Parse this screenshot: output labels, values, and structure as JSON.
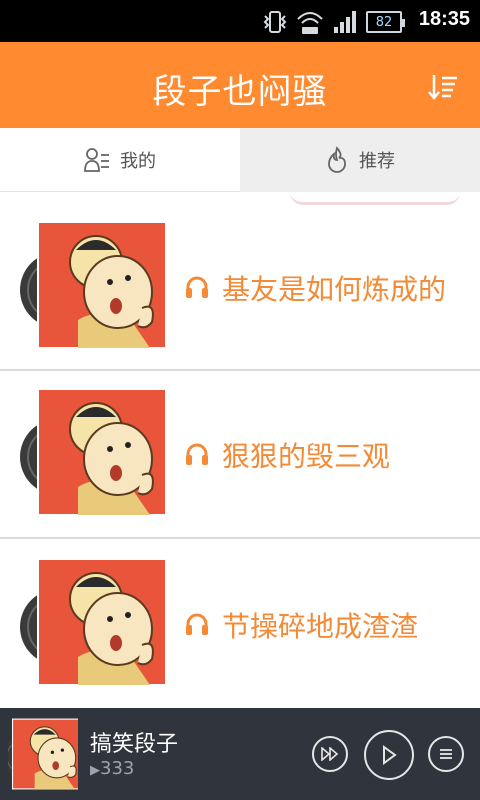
{
  "status_bar": {
    "time": "18:35",
    "battery": "82"
  },
  "header": {
    "title": "段子也闷骚"
  },
  "tabs": [
    {
      "label": "我的",
      "icon": "user-list-icon"
    },
    {
      "label": "推荐",
      "icon": "flame-icon"
    }
  ],
  "list": {
    "items": [
      {
        "title": "基友是如何炼成的",
        "icon": "headphones-icon"
      },
      {
        "title": "狠狠的毁三观",
        "icon": "headphones-icon"
      },
      {
        "title": "节操碎地成渣渣",
        "icon": "headphones-icon"
      }
    ]
  },
  "player": {
    "title": "搞笑段子",
    "play_count": "333",
    "icons": [
      "fast-forward-icon",
      "play-icon",
      "menu-icon"
    ]
  },
  "colors": {
    "accent": "#ff8a2f",
    "title_text": "#f28a36",
    "player_bg": "#30343d"
  }
}
